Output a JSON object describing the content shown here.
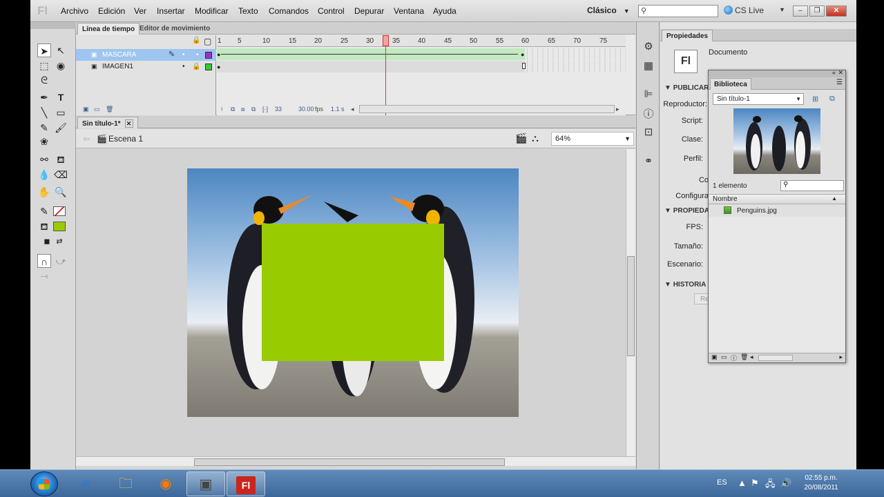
{
  "menubar": {
    "logo": "Fl",
    "items": [
      "Archivo",
      "Edición",
      "Ver",
      "Insertar",
      "Modificar",
      "Texto",
      "Comandos",
      "Control",
      "Depurar",
      "Ventana",
      "Ayuda"
    ],
    "workspace": "Clásico",
    "search_value": "",
    "cslive": "CS Live"
  },
  "timeline": {
    "tabs": [
      "Línea de tiempo",
      "Editor de movimiento"
    ],
    "layers": [
      {
        "name": "MASCARA",
        "color": "#9933cc"
      },
      {
        "name": "IMAGEN1",
        "color": "#33cc33"
      }
    ],
    "ruler": [
      "1",
      "5",
      "10",
      "15",
      "20",
      "25",
      "30",
      "35",
      "40",
      "45",
      "50",
      "55",
      "60",
      "65",
      "70",
      "75"
    ],
    "current_frame": "33",
    "fps": "30.00",
    "fps_unit": "fps",
    "time": "1.1 s"
  },
  "document": {
    "tab": "Sin título-1*",
    "scene": "Escena 1",
    "zoom": "64%"
  },
  "canvas": {
    "mask_color": "#99cc00"
  },
  "properties": {
    "tab": "Propiedades",
    "fl_box": "Fl",
    "doc_label": "Documento",
    "sections": [
      "PUBLICAR",
      "PROPIEDA",
      "HISTORIA"
    ],
    "labels": [
      "Reproductor:",
      "Script:",
      "Clase:",
      "Perfil:",
      "Co",
      "Configura",
      "FPS:",
      "Tamaño:",
      "Escenario:"
    ],
    "history_btn": "Re"
  },
  "library": {
    "tab": "Biblioteca",
    "document": "Sin título-1",
    "count": "1 elemento",
    "search_value": "",
    "column": "Nombre",
    "items": [
      "Penguins.jpg"
    ]
  },
  "taskbar": {
    "lang": "ES",
    "time": "02:55 p.m.",
    "date": "20/08/2011"
  }
}
